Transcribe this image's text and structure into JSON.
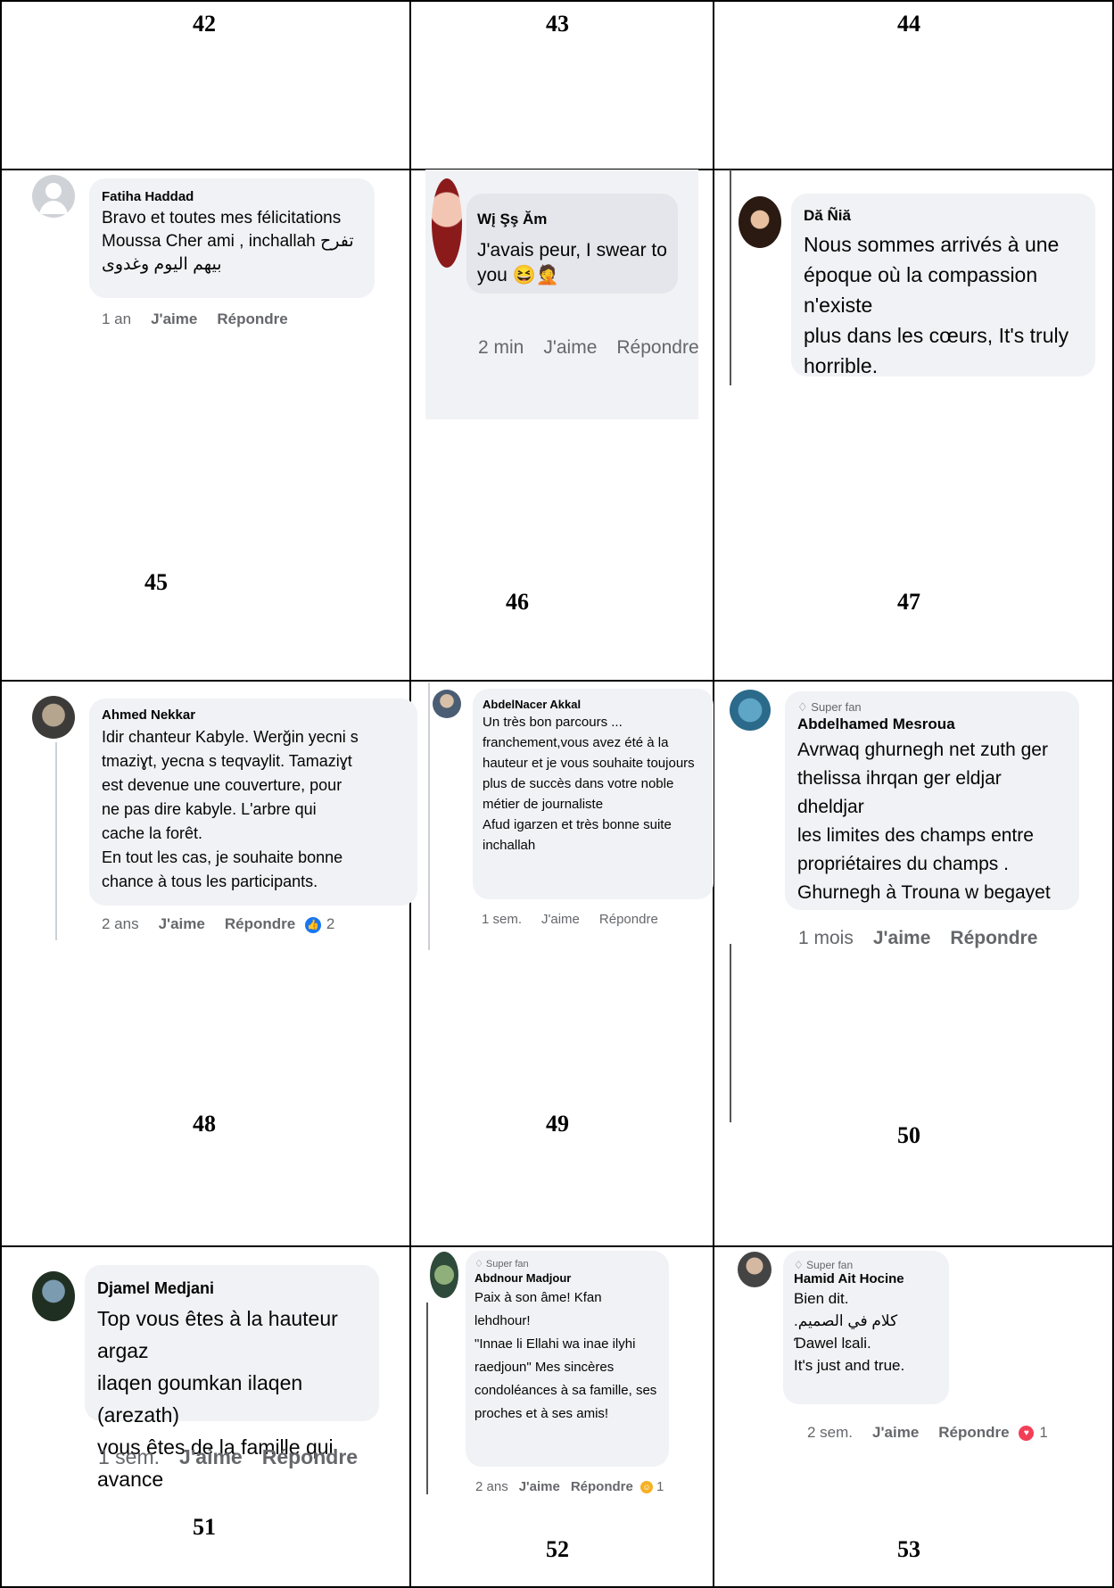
{
  "numbers": [
    "42",
    "43",
    "44",
    "45",
    "46",
    "47",
    "48",
    "49",
    "50",
    "51",
    "52",
    "53"
  ],
  "comments": [
    {
      "name": "Fatiha Haddad",
      "text": "Bravo et toutes mes félicitations\nMoussa Cher ami , inchallah تفرح\nبيهم اليوم وغدوى",
      "time": "1 an",
      "like": "J'aime",
      "reply": "Répondre"
    },
    {
      "name": "Wį Şş Ăm",
      "text": "J'avais peur, I swear to you 😆🤦",
      "time": "2 min",
      "like": "J'aime",
      "reply": "Répondre"
    },
    {
      "name": "Dă Ñiă",
      "text": "Nous sommes arrivés à une\népoque où la compassion n'existe\nplus dans les cœurs, It's truly\nhorrible."
    },
    {
      "name": "Ahmed Nekkar",
      "text": "Idir chanteur Kabyle. Werğin yecni s\ntmaziɣt, yecna s teqvaylit. Tamaziɣt\nest devenue une couverture, pour\nne pas dire kabyle. L'arbre qui\ncache la forêt.\nEn tout les cas, je souhaite bonne\nchance à tous les participants.",
      "time": "2 ans",
      "like": "J'aime",
      "reply": "Répondre",
      "reactions": "2"
    },
    {
      "name": "AbdelNacer Akkal",
      "text": "Un très bon parcours ...\nfranchement,vous avez été à la\nhauteur et je vous souhaite toujours\nplus de succès dans votre noble\nmétier de journaliste\nAfud igarzen et très  bonne suite\ninchallah",
      "time": "1 sem.",
      "like": "J'aime",
      "reply": "Répondre"
    },
    {
      "badge": "Super fan",
      "name": "Abdelhamed Mesroua",
      "text": "Avrwaq ghurnegh net zuth ger\nthelissa ihrqan ger eldjar dheldjar\nles limites des champs entre\npropriétaires du champs .\nGhurnegh à Trouna w begayet",
      "time": "1 mois",
      "like": "J'aime",
      "reply": "Répondre"
    },
    {
      "name": "Djamel Medjani",
      "text": "Top vous êtes à la hauteur argaz\nilaqen goumkan  ilaqen (arezath)\nvous êtes de la famille qui avance",
      "time": "1 sem.",
      "like": "J'aime",
      "reply": "Répondre"
    },
    {
      "badge": "Super fan",
      "name": "Abdnour Madjour",
      "text": "Paix à son âme! Kfan lehdhour!\n\"Innae li Ellahi wa inae ilyhi\nraedjoun\" Mes sincères\ncondoléances à sa famille, ses\nproches et à ses amis!",
      "time": "2 ans",
      "like": "J'aime",
      "reply": "Répondre",
      "reactions": "1"
    },
    {
      "badge": "Super fan",
      "name": "Hamid Ait Hocine",
      "text": "Bien dit.\n.كلام في الصميم\nƊawel lɛali.\nIt's just and true.",
      "time": "2 sem.",
      "like": "J'aime",
      "reply": "Répondre",
      "reactions": "1"
    }
  ],
  "colors": {
    "bubble": "#f0f2f5",
    "meta": "#65676b",
    "like_reaction": "#1877f2",
    "love_reaction": "#f33e58",
    "haha_reaction": "#f7b125"
  }
}
